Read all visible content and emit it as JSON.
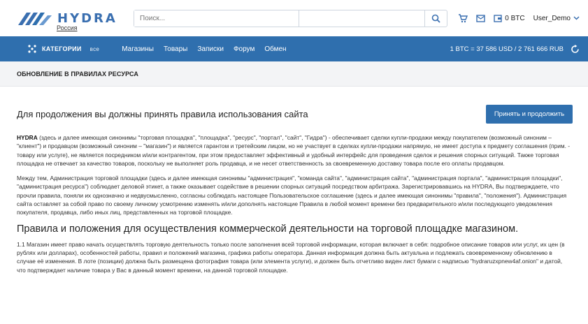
{
  "header": {
    "logo_text": "HYDRA",
    "logo_region": "Россия",
    "search_placeholder": "Поиск...",
    "balance": "0 BTC",
    "username": "User_Demo"
  },
  "nav": {
    "categories_label": "КАТЕГОРИИ",
    "categories_all": "все",
    "links": [
      "Магазины",
      "Товары",
      "Записки",
      "Форум",
      "Обмен"
    ],
    "rate": "1 BTC = 37 586 USD  /  2 761 666 RUB"
  },
  "band": {
    "title": "ОБНОВЛЕНИЕ В ПРАВИЛАХ РЕСУРСА"
  },
  "main": {
    "accept_heading": "Для продолжения вы должны принять правила использования сайта",
    "accept_button": "Принять и продолжить",
    "p1_bold": "HYDRA",
    "p1_rest": " (здесь и далее имеющая синонимы \"торговая площадка\", \"площадка\", \"ресурс\", \"портал\", \"сайт\", \"Гидра\") - обеспечивает сделки купли-продажи между покупателем (возможный синоним – \"клиент\") и продавцом (возможный синоним – \"магазин\") и является гарантом и третейским лицом, но не участвует в сделках купли-продажи напрямую, не имеет доступа к предмету соглашения (прим. - товару или услуге), не является посредником и/или контрагентом, при этом предоставляет эффективный и удобный интерфейс для проведения сделок и решения спорных ситуаций. Также торговая площадка не отвечает за качество товаров, поскольку не выполняет роль продавца, и не несет ответственность за своевременную доставку товара после его оплаты продавцом.",
    "p2": "Между тем, Администрация торговой площадки (здесь и далее имеющая синонимы \"администрация\", \"команда сайта\", \"администрация сайта\", \"администрация портала\", \"администрация площадки\", \"администрация ресурса\") соблюдает деловой этикет, а также оказывает содействие в решении спорных ситуаций посредством арбитража. Зарегистрировавшись на HYDRA, Вы подтверждаете, что прочли правила, поняли их однозначно и недвусмысленно, согласны соблюдать настоящее Пользовательское соглашение (здесь и далее имеющая синонимы \"правила\", \"положения\"). Администрация сайта оставляет за собой право по своему личному усмотрению изменять и/или дополнять настоящие Правила в любой момент времени без предварительного и/или последующего уведомления покупателя, продавца, либо иных лиц, представленных на торговой площадке.",
    "section_title": "Правила и положения для осуществления коммерческой деятельности на торговой площадке магазином.",
    "p3": "1.1 Магазин имеет право начать осуществлять торговую деятельность только после заполнения всей торговой информации, которая включает в себя: подробное описание товаров или услуг, их цен (в рублях или долларах), особенностей работы, правил и положений магазина, графика работы оператора. Данная информация должна быть актуальна и подлежать своевременному обновлению в случае её изменения. В лоте (позиции) должна быть размещена фотография товара (или элемента услуги), и должен быть отчетливо виден лист бумаги с надписью \"hydraruzxpnew4af.onion\" и датой, что подтверждает наличие товара у Вас в данный момент времени, на данной торговой площадке."
  },
  "colors": {
    "brand": "#2f6fae",
    "logo": "#3a6fb0",
    "band": "#f3f4f6"
  }
}
